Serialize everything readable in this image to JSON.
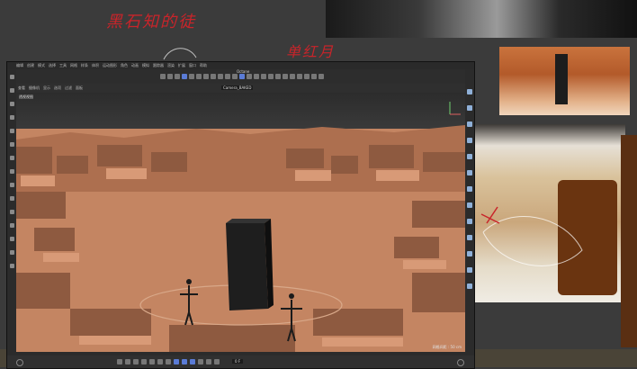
{
  "app": {
    "title": "Camera_BAKED",
    "menus": [
      "编辑",
      "创建",
      "模式",
      "选择",
      "工具",
      "网格",
      "样条",
      "体积",
      "运动图形",
      "角色",
      "动画",
      "模拟",
      "跟踪器",
      "渲染",
      "扩展",
      "窗口",
      "帮助"
    ],
    "render_label": "Octane",
    "viewport_menus": [
      "查看",
      "摄像机",
      "显示",
      "选项",
      "过滤",
      "面板"
    ],
    "viewport_name": "透视视图",
    "bottom_readout": "网格间距 : 50 cm",
    "frame_value": "0 F",
    "left_tool_icons": [
      "move-icon",
      "scale-icon",
      "rotate-icon",
      "select-icon",
      "cube-icon",
      "pen-icon",
      "brush-icon",
      "knife-icon",
      "paint-icon",
      "sculpt-icon",
      "eye-icon",
      "cog-icon",
      "layers-icon",
      "wave-icon",
      "lock-icon"
    ],
    "right_tool_icons": [
      "object-icon",
      "camera-icon",
      "text-icon",
      "light-icon",
      "flower-icon",
      "gear-icon",
      "cloud-icon",
      "sphere-icon",
      "bend-icon",
      "cone-icon",
      "target-icon",
      "bulb-icon",
      "gear2-icon"
    ],
    "toolbar_icons": [
      "undo-icon",
      "redo-icon",
      "pointer-icon",
      "move-icon",
      "scale-icon",
      "rotate-icon",
      "lock-icon",
      "x-axis-icon",
      "y-axis-icon",
      "z-axis-icon",
      "world-icon",
      "render-icon",
      "render-region-icon",
      "render-settings-icon",
      "cube-icon",
      "spline-icon",
      "nurbs-icon",
      "array-icon",
      "field-icon",
      "deformer-icon",
      "scene-icon",
      "camera-icon",
      "light-icon"
    ],
    "timeline_icons": [
      "first-frame-icon",
      "prev-key-icon",
      "prev-frame-icon",
      "play-icon",
      "next-frame-icon",
      "next-key-icon",
      "last-frame-icon",
      "loop-icon",
      "record-icon",
      "auto-key-icon",
      "key-icon",
      "motion-icon",
      "settings-icon"
    ]
  },
  "notes": {
    "top_note": "黑石知的徒",
    "side_note": "单红月"
  },
  "colors": {
    "accent": "#5a7bd6",
    "viewport_sand": "#c48562",
    "monolith": "#1e1e1e"
  }
}
